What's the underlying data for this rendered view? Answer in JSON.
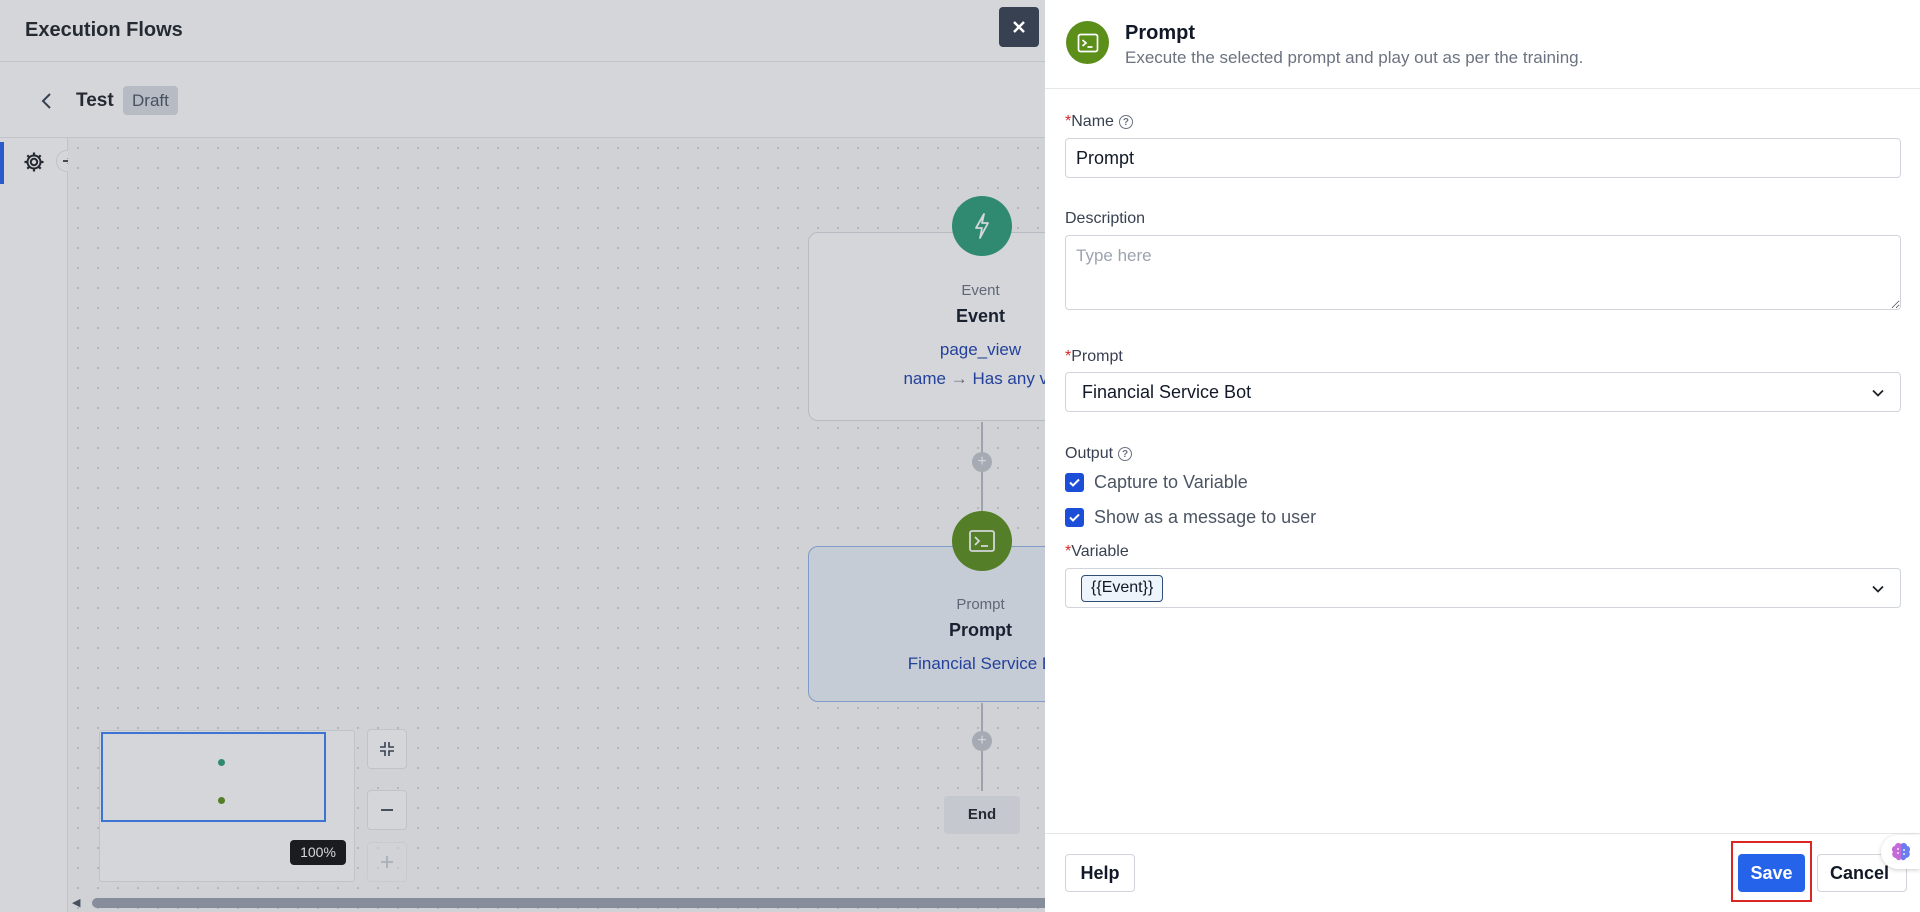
{
  "app": {
    "title": "Execution Flows"
  },
  "flow": {
    "name": "Test",
    "status": "Draft"
  },
  "canvas": {
    "zoom": "100%",
    "nodes": [
      {
        "type": "Event",
        "title": "Event",
        "detail1": "page_view",
        "detail2_key": "name",
        "detail2_arrow": "→",
        "detail2_val": "Has any va"
      },
      {
        "type": "Prompt",
        "title": "Prompt",
        "detail1": "Financial Service B"
      }
    ],
    "end_label": "End",
    "plus_symbol": "+"
  },
  "drawer": {
    "title": "Prompt",
    "subtitle": "Execute the selected prompt and play out as per the training.",
    "name_label": "Name",
    "name_value": "Prompt",
    "description_label": "Description",
    "description_placeholder": "Type here",
    "prompt_label": "Prompt",
    "prompt_value": "Financial Service Bot",
    "output_label": "Output",
    "options": [
      {
        "label": "Capture to Variable",
        "checked": true
      },
      {
        "label": "Show as a message to user",
        "checked": true
      }
    ],
    "variable_label": "Variable",
    "variable_chip": "{{Event}}",
    "required_mark": "*",
    "help_mark": "?",
    "help_button": "Help",
    "save_button": "Save",
    "cancel_button": "Cancel"
  },
  "colors": {
    "accent": "#2563eb",
    "event_green": "#2e9e7a",
    "prompt_green": "#5b8f1a",
    "highlight": "#dc2626"
  }
}
